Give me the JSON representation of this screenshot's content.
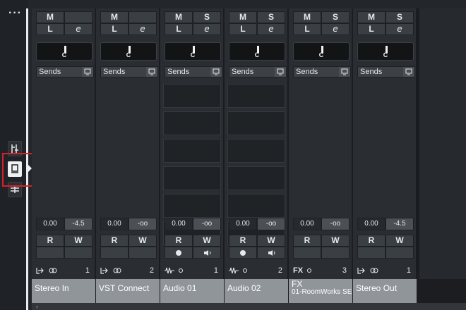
{
  "toolbar": {
    "menu_icon": "ellipsis-icon"
  },
  "left_buttons": [
    {
      "icon": "fader-settings-icon",
      "active": false
    },
    {
      "icon": "monitor-icon",
      "active": true
    },
    {
      "icon": "sends-routing-icon",
      "active": false
    }
  ],
  "labels": {
    "mute": "M",
    "solo": "S",
    "listen": "L",
    "edit": "e",
    "sends": "Sends",
    "read": "R",
    "write": "W",
    "pan_center": "C"
  },
  "channels": [
    {
      "name": "Stereo In",
      "name2": "",
      "type": "input",
      "has_solo": false,
      "slots": false,
      "vol_a": "0.00",
      "vol_b": "-4.5",
      "has_row2": false,
      "io_prefix": "",
      "number": "1"
    },
    {
      "name": "VST Connect",
      "name2": "",
      "type": "input",
      "has_solo": false,
      "slots": false,
      "vol_a": "0.00",
      "vol_b": "-oo",
      "has_row2": false,
      "io_prefix": "",
      "number": "2"
    },
    {
      "name": "Audio 01",
      "name2": "",
      "type": "audio",
      "has_solo": true,
      "slots": true,
      "vol_a": "0.00",
      "vol_b": "-oo",
      "has_row2": true,
      "io_prefix": "",
      "number": "1"
    },
    {
      "name": "Audio 02",
      "name2": "",
      "type": "audio",
      "has_solo": true,
      "slots": true,
      "vol_a": "0.00",
      "vol_b": "-oo",
      "has_row2": true,
      "io_prefix": "",
      "number": "2"
    },
    {
      "name": "FX",
      "name2": "01-RoomWorks SE",
      "type": "fx",
      "has_solo": true,
      "slots": false,
      "vol_a": "0.00",
      "vol_b": "-oo",
      "has_row2": false,
      "io_prefix": "FX",
      "number": "3"
    },
    {
      "name": "Stereo Out",
      "name2": "",
      "type": "output",
      "has_solo": true,
      "slots": false,
      "vol_a": "0.00",
      "vol_b": "-4.5",
      "has_row2": false,
      "io_prefix": "",
      "number": "1"
    }
  ]
}
